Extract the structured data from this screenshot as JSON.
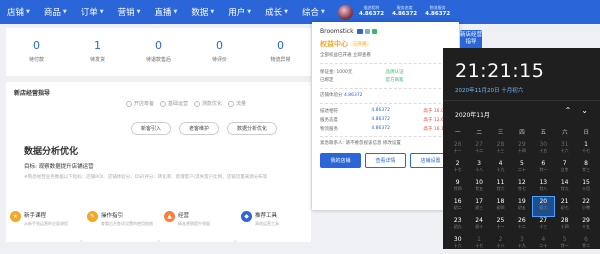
{
  "nav": {
    "items": [
      "店铺",
      "商品",
      "订单",
      "营销",
      "直播",
      "数据",
      "用户",
      "成长",
      "综合"
    ],
    "metrics": [
      {
        "label": "描述相符",
        "value": "4.86372"
      },
      {
        "label": "服务态度",
        "value": "4.86372"
      },
      {
        "label": "物流服务",
        "value": "4.86372"
      }
    ]
  },
  "stats": [
    {
      "num": "0",
      "label": "待付款"
    },
    {
      "num": "1",
      "label": "待发货"
    },
    {
      "num": "0",
      "label": "待退款售后"
    },
    {
      "num": "0",
      "label": "待评价"
    },
    {
      "num": "0",
      "label": "物流异常"
    }
  ],
  "guide": {
    "title": "新店经营指导",
    "steps": [
      "开店筹备",
      "基础运营",
      "测款优化",
      "流量"
    ],
    "tabs": [
      "新客引入",
      "老客维护",
      "数据分析优化"
    ],
    "section_title": "数据分析优化",
    "section_sub": "目标: 观察数据提升店铺运营",
    "section_desc": "※熟悉经营业务数据以下指标：店铺ROI、店铺体验分、DSR评分、转化率、新增客户/流失客户比例、店铺流量来源分布等"
  },
  "cards": [
    {
      "title": "新手课程",
      "desc": "从新手到运营的全面课程",
      "color": "#f5a623",
      "icon": "★"
    },
    {
      "title": "操作指引",
      "desc": "查看后台各项设置的使用指南",
      "color": "#f5a623",
      "icon": "✎"
    },
    {
      "title": "经营",
      "desc": "精准营销提升销量",
      "color": "#ff7a3d",
      "icon": "▲"
    },
    {
      "title": "推荐工具",
      "desc": "高效运营工具",
      "color": "#2a66d8",
      "icon": "◆"
    }
  ],
  "popup": {
    "name": "Broomstick",
    "gold": "权益中心",
    "gold_badge": "已开通",
    "row1": "全部权益已开通 立即查看",
    "deposit_label": "保证金: 1000元",
    "auth_label": "品牌认证",
    "bind_label": "已绑定",
    "official_label": "官方商家",
    "experience_label": "店铺体验分",
    "experience_value": "4.86372",
    "dsr": [
      {
        "name": "描述相符",
        "value": "4.86372",
        "cmp": "高于 16.09%"
      },
      {
        "name": "服务态度",
        "value": "4.86372",
        "cmp": "高于 12.61%"
      },
      {
        "name": "物流服务",
        "value": "4.86372",
        "cmp": "高于 16.16%"
      }
    ],
    "note": "紧急联系人: 请不要忽视该信息 修改设置",
    "buttons": [
      "我的店铺",
      "查看详情",
      "店铺设置"
    ]
  },
  "side_button": "新店经营指导",
  "clock": {
    "time": "21:21:15",
    "date": "2020年11月20日 十月初六",
    "month": "2020年11月",
    "weekdays": [
      "一",
      "二",
      "三",
      "四",
      "五",
      "六",
      "日"
    ],
    "days": [
      {
        "d": "26",
        "l": "十一",
        "dim": true
      },
      {
        "d": "27",
        "l": "十二",
        "dim": true
      },
      {
        "d": "28",
        "l": "十三",
        "dim": true
      },
      {
        "d": "29",
        "l": "十四",
        "dim": true
      },
      {
        "d": "30",
        "l": "十五",
        "dim": true
      },
      {
        "d": "31",
        "l": "十六",
        "dim": true
      },
      {
        "d": "1",
        "l": "十七"
      },
      {
        "d": "2",
        "l": "十七"
      },
      {
        "d": "3",
        "l": "十八"
      },
      {
        "d": "4",
        "l": "十九"
      },
      {
        "d": "5",
        "l": "二十"
      },
      {
        "d": "6",
        "l": "廿一"
      },
      {
        "d": "7",
        "l": "立冬"
      },
      {
        "d": "8",
        "l": "廿三"
      },
      {
        "d": "9",
        "l": "廿四"
      },
      {
        "d": "10",
        "l": "廿五"
      },
      {
        "d": "11",
        "l": "廿六"
      },
      {
        "d": "12",
        "l": "廿七"
      },
      {
        "d": "13",
        "l": "廿八"
      },
      {
        "d": "14",
        "l": "廿九"
      },
      {
        "d": "15",
        "l": "十月"
      },
      {
        "d": "16",
        "l": "初二"
      },
      {
        "d": "17",
        "l": "初三"
      },
      {
        "d": "18",
        "l": "初四"
      },
      {
        "d": "19",
        "l": "初五"
      },
      {
        "d": "20",
        "l": "初六",
        "today": true
      },
      {
        "d": "21",
        "l": "初七"
      },
      {
        "d": "22",
        "l": "小雪"
      },
      {
        "d": "23",
        "l": "初九"
      },
      {
        "d": "24",
        "l": "初十"
      },
      {
        "d": "25",
        "l": "十一"
      },
      {
        "d": "26",
        "l": "十二"
      },
      {
        "d": "27",
        "l": "十三"
      },
      {
        "d": "28",
        "l": "十四"
      },
      {
        "d": "29",
        "l": "十五"
      },
      {
        "d": "30",
        "l": "十六"
      },
      {
        "d": "1",
        "l": "十七",
        "dim": true
      },
      {
        "d": "2",
        "l": "十八",
        "dim": true
      },
      {
        "d": "3",
        "l": "十九",
        "dim": true
      },
      {
        "d": "4",
        "l": "二十",
        "dim": true
      },
      {
        "d": "5",
        "l": "廿一",
        "dim": true
      },
      {
        "d": "6",
        "l": "廿二",
        "dim": true
      }
    ]
  }
}
